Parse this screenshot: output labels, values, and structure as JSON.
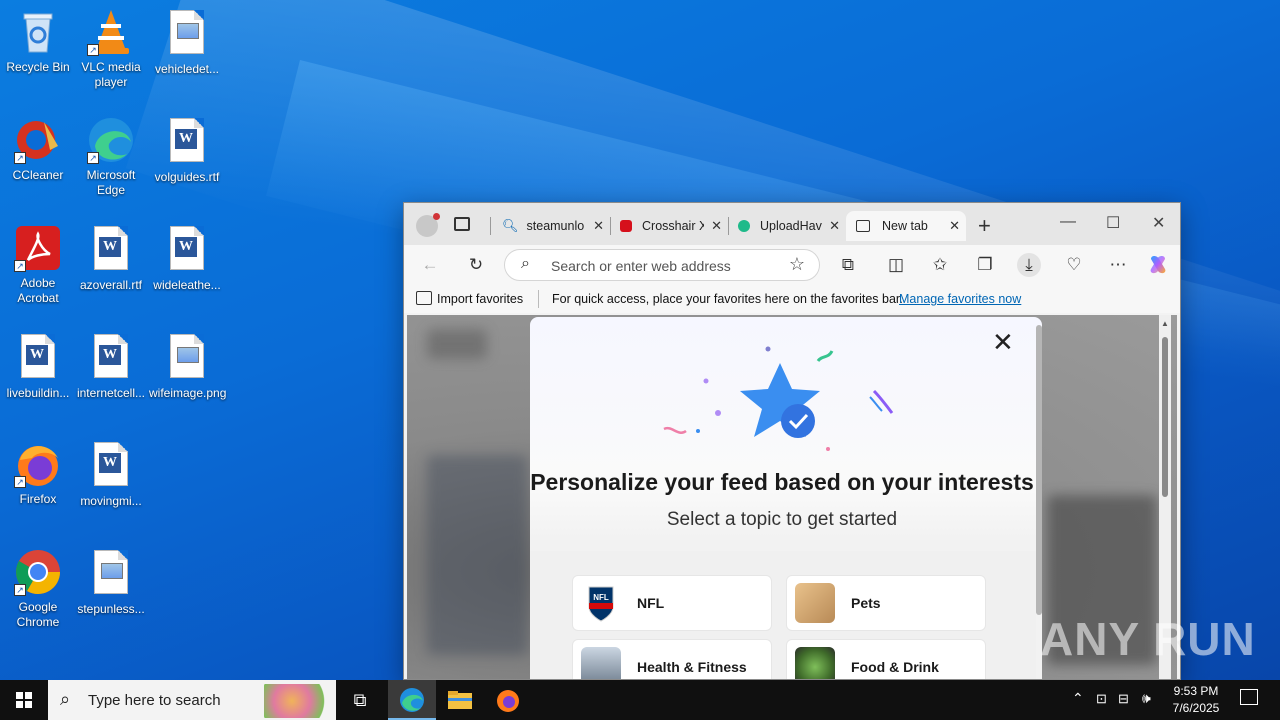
{
  "desktop": {
    "icons": [
      {
        "label": "Recycle Bin"
      },
      {
        "label": "VLC media player"
      },
      {
        "label": "vehicledet..."
      },
      {
        "label": "CCleaner"
      },
      {
        "label": "Microsoft Edge"
      },
      {
        "label": "volguides.rtf"
      },
      {
        "label": "Adobe Acrobat"
      },
      {
        "label": "azoverall.rtf"
      },
      {
        "label": "wideleathe..."
      },
      {
        "label": "livebuildin..."
      },
      {
        "label": "internetcell..."
      },
      {
        "label": "wifeimage.png"
      },
      {
        "label": "Firefox"
      },
      {
        "label": "movingmi..."
      },
      {
        "label": "Google Chrome"
      },
      {
        "label": "stepunless..."
      }
    ]
  },
  "browser": {
    "tabs": [
      {
        "title": "steamunlo"
      },
      {
        "title": "Crosshair X"
      },
      {
        "title": "UploadHav"
      },
      {
        "title": "New tab"
      }
    ],
    "address_placeholder": "Search or enter web address",
    "favbar": {
      "import_label": "Import favorites",
      "message": "For quick access, place your favorites here on the favorites bar.",
      "manage_link": "Manage favorites now"
    },
    "modal": {
      "title": "Personalize your feed based on your interests",
      "subtitle": "Select a topic to get started",
      "topics": [
        {
          "label": "NFL"
        },
        {
          "label": "Pets"
        },
        {
          "label": "Health & Fitness"
        },
        {
          "label": "Food & Drink"
        }
      ]
    }
  },
  "taskbar": {
    "search_placeholder": "Type here to search",
    "time": "9:53 PM",
    "date": "7/6/2025"
  },
  "watermark": "ANY RUN"
}
